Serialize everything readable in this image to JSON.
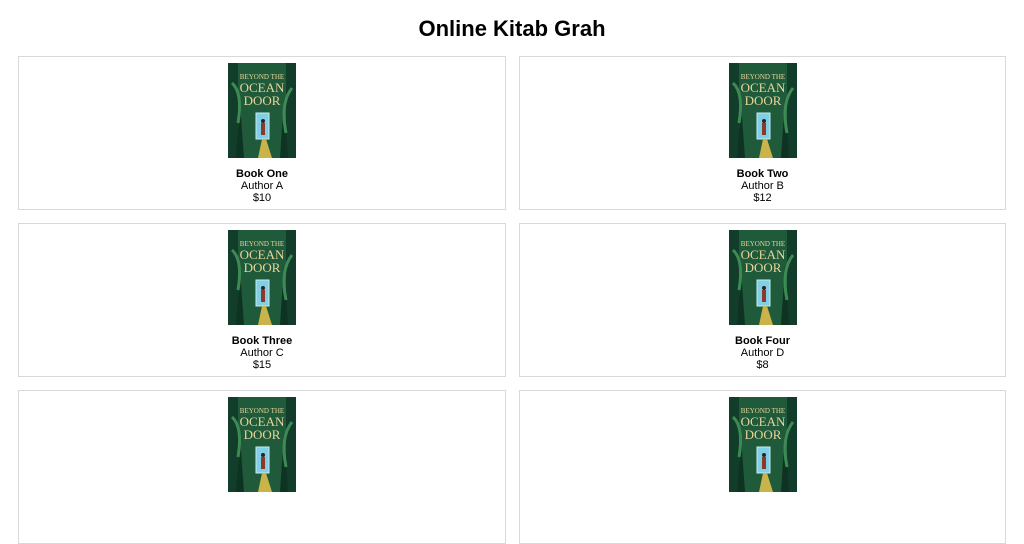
{
  "page": {
    "title": "Online Kitab Grah"
  },
  "cover": {
    "line1": "BEYOND THE",
    "line2": "OCEAN",
    "line3": "DOOR"
  },
  "books": [
    {
      "title": "Book One",
      "author": "Author A",
      "price": "$10"
    },
    {
      "title": "Book Two",
      "author": "Author B",
      "price": "$12"
    },
    {
      "title": "Book Three",
      "author": "Author C",
      "price": "$15"
    },
    {
      "title": "Book Four",
      "author": "Author D",
      "price": "$8"
    },
    {
      "title": "",
      "author": "",
      "price": ""
    },
    {
      "title": "",
      "author": "",
      "price": ""
    }
  ],
  "colors": {
    "cover_green_dark": "#123d2a",
    "cover_green": "#2f7a4a",
    "cover_text": "#e9d59a",
    "door_blue": "#7fd0e6",
    "card_border": "#d9d9d9"
  }
}
